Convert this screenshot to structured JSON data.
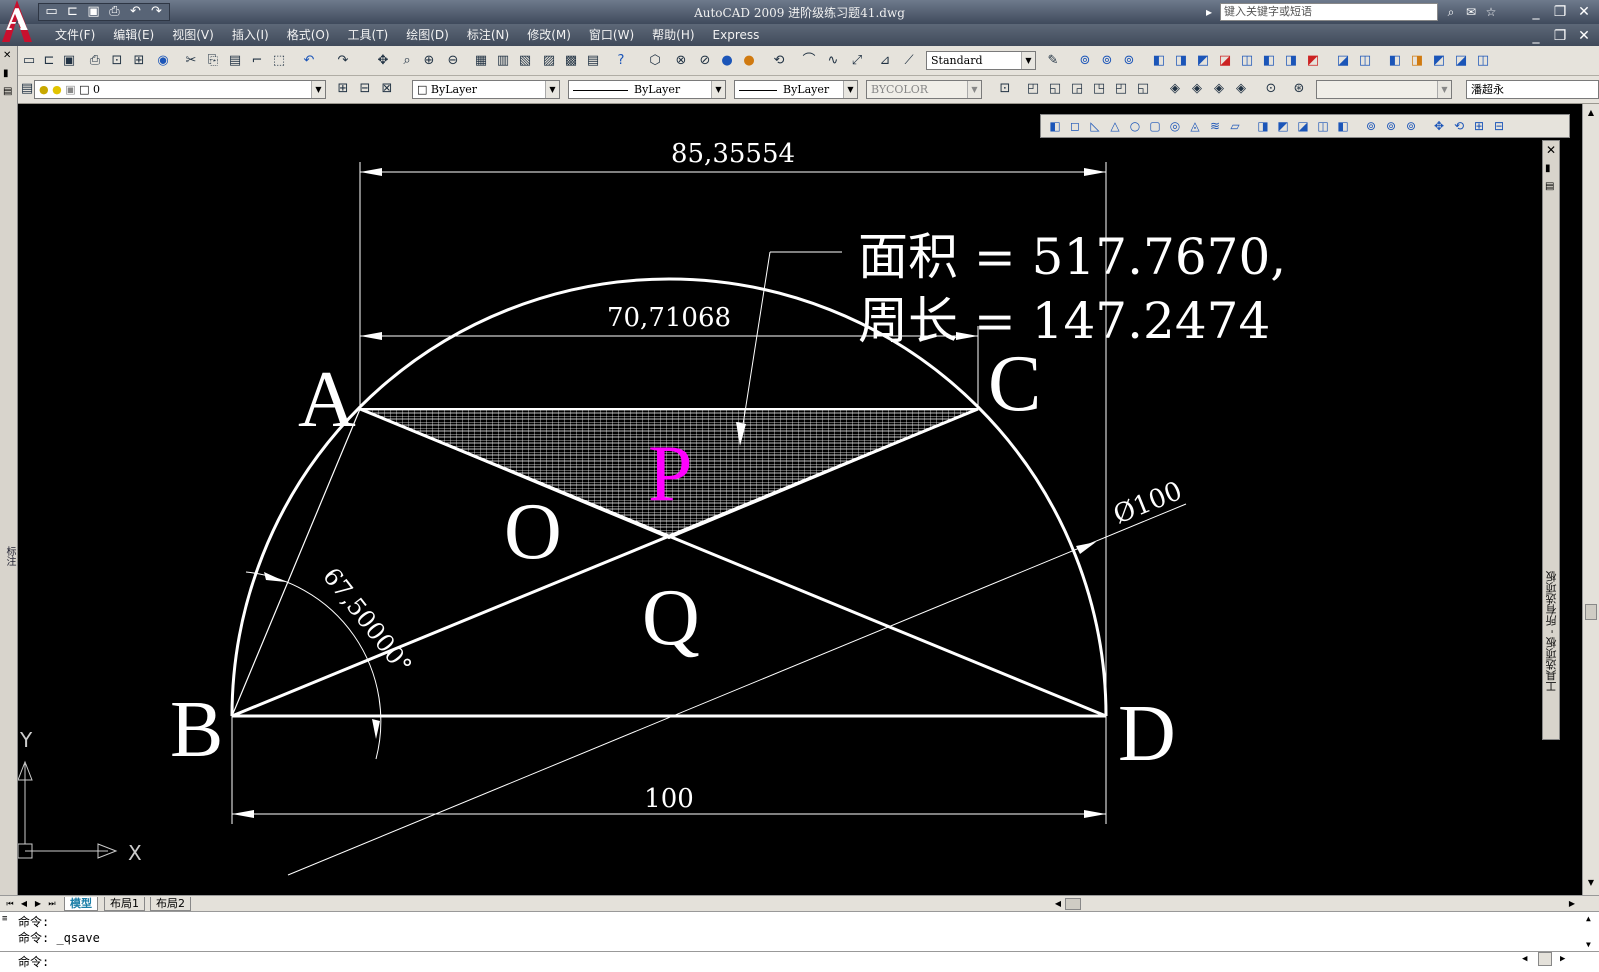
{
  "app": {
    "title": "AutoCAD 2009  进阶级练习题41.dwg",
    "search_placeholder": "键入关键字或短语",
    "accent": "#c8102e"
  },
  "menu": [
    "文件(F)",
    "编辑(E)",
    "视图(V)",
    "插入(I)",
    "格式(O)",
    "工具(T)",
    "绘图(D)",
    "标注(N)",
    "修改(M)",
    "窗口(W)",
    "帮助(H)",
    "Express"
  ],
  "toolbar": {
    "text_style": "Standard",
    "layer": "0",
    "color": "ByLayer",
    "linetype": "ByLayer",
    "lineweight": "ByLayer",
    "plotstyle": "BYCOLOR",
    "user": "潘超永"
  },
  "left_panel_label": "标注",
  "palette_label": "工具选项板 - 所有选项板",
  "drawing": {
    "dim_top": "85,35554",
    "dim_mid": "70,71068",
    "dim_bottom": "100",
    "dim_diameter": "Ø100",
    "dim_angle": "67,50000°",
    "area_line": "面积 = 517.7670,",
    "perimeter_line": "周长 = 147.2474",
    "point_a": "A",
    "point_b": "B",
    "point_c": "C",
    "point_d": "D",
    "point_o": "O",
    "point_p": "P",
    "point_q": "Q",
    "ucs_x": "X",
    "ucs_y": "Y",
    "colors": {
      "background": "#000000",
      "lines": "#ffffff",
      "label_p": "#ff00ff"
    }
  },
  "tabs": [
    "模型",
    "布局1",
    "布局2"
  ],
  "command": {
    "line1": "命令:",
    "line2": "命令: _qsave",
    "prompt": "命令:"
  }
}
